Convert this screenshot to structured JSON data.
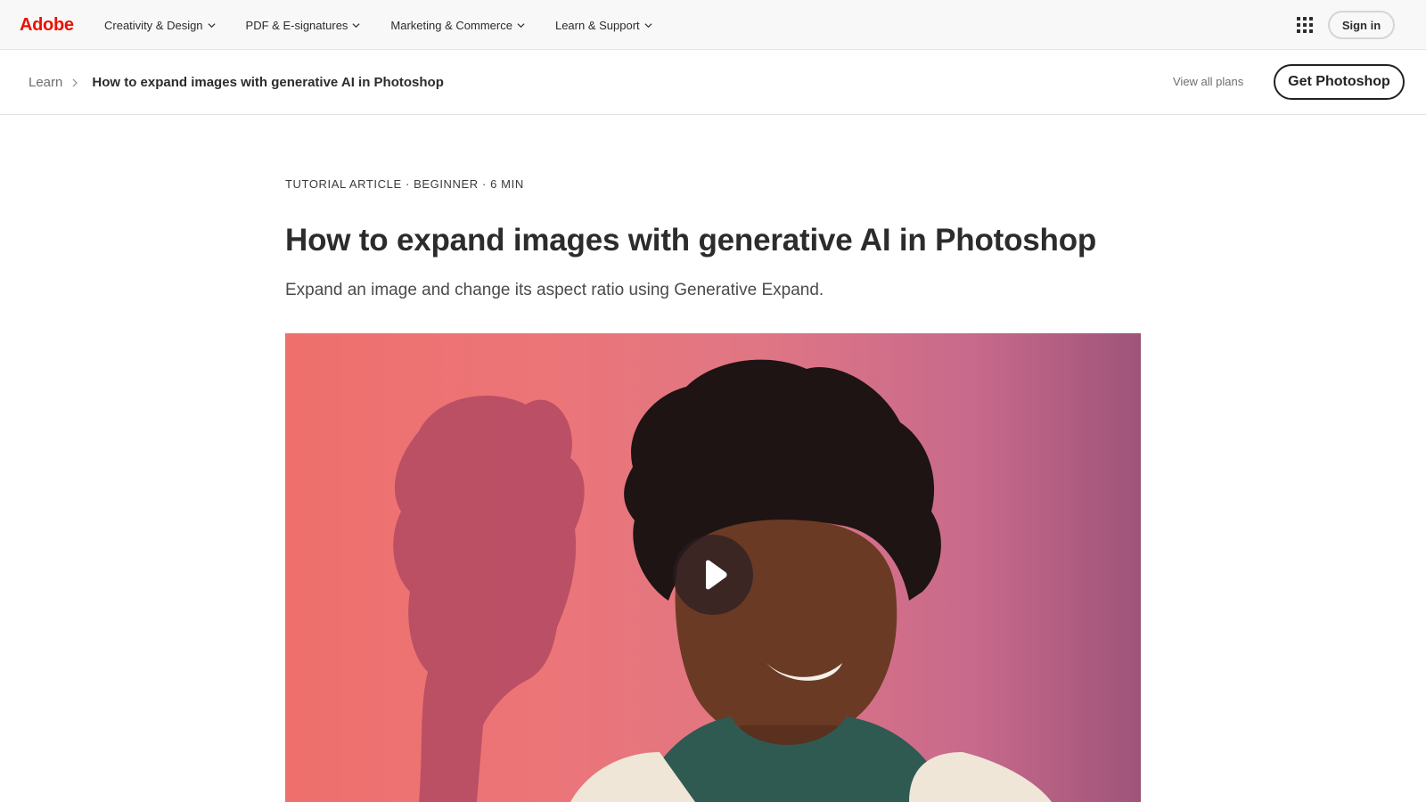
{
  "global_nav": {
    "logo": "Adobe",
    "items": [
      {
        "label": "Creativity & Design"
      },
      {
        "label": "PDF & E-signatures"
      },
      {
        "label": "Marketing & Commerce"
      },
      {
        "label": "Learn & Support"
      }
    ],
    "apps_icon": "app-grid-icon",
    "sign_in": "Sign in"
  },
  "local_nav": {
    "breadcrumb": {
      "root": "Learn",
      "current": "How to expand images with generative AI in Photoshop"
    },
    "view_all_plans": "View all plans",
    "cta": "Get Photoshop"
  },
  "article": {
    "eyebrow": "Tutorial Article · Beginner · 6 min",
    "title": "How to expand images with generative AI in Photoshop",
    "subtitle": "Expand an image and change its aspect ratio using Generative Expand."
  },
  "media": {
    "play_icon": "play-icon"
  },
  "colors": {
    "brand": "#eb1000",
    "text": "#2c2c2c",
    "nav_bg": "#f8f8f8"
  }
}
